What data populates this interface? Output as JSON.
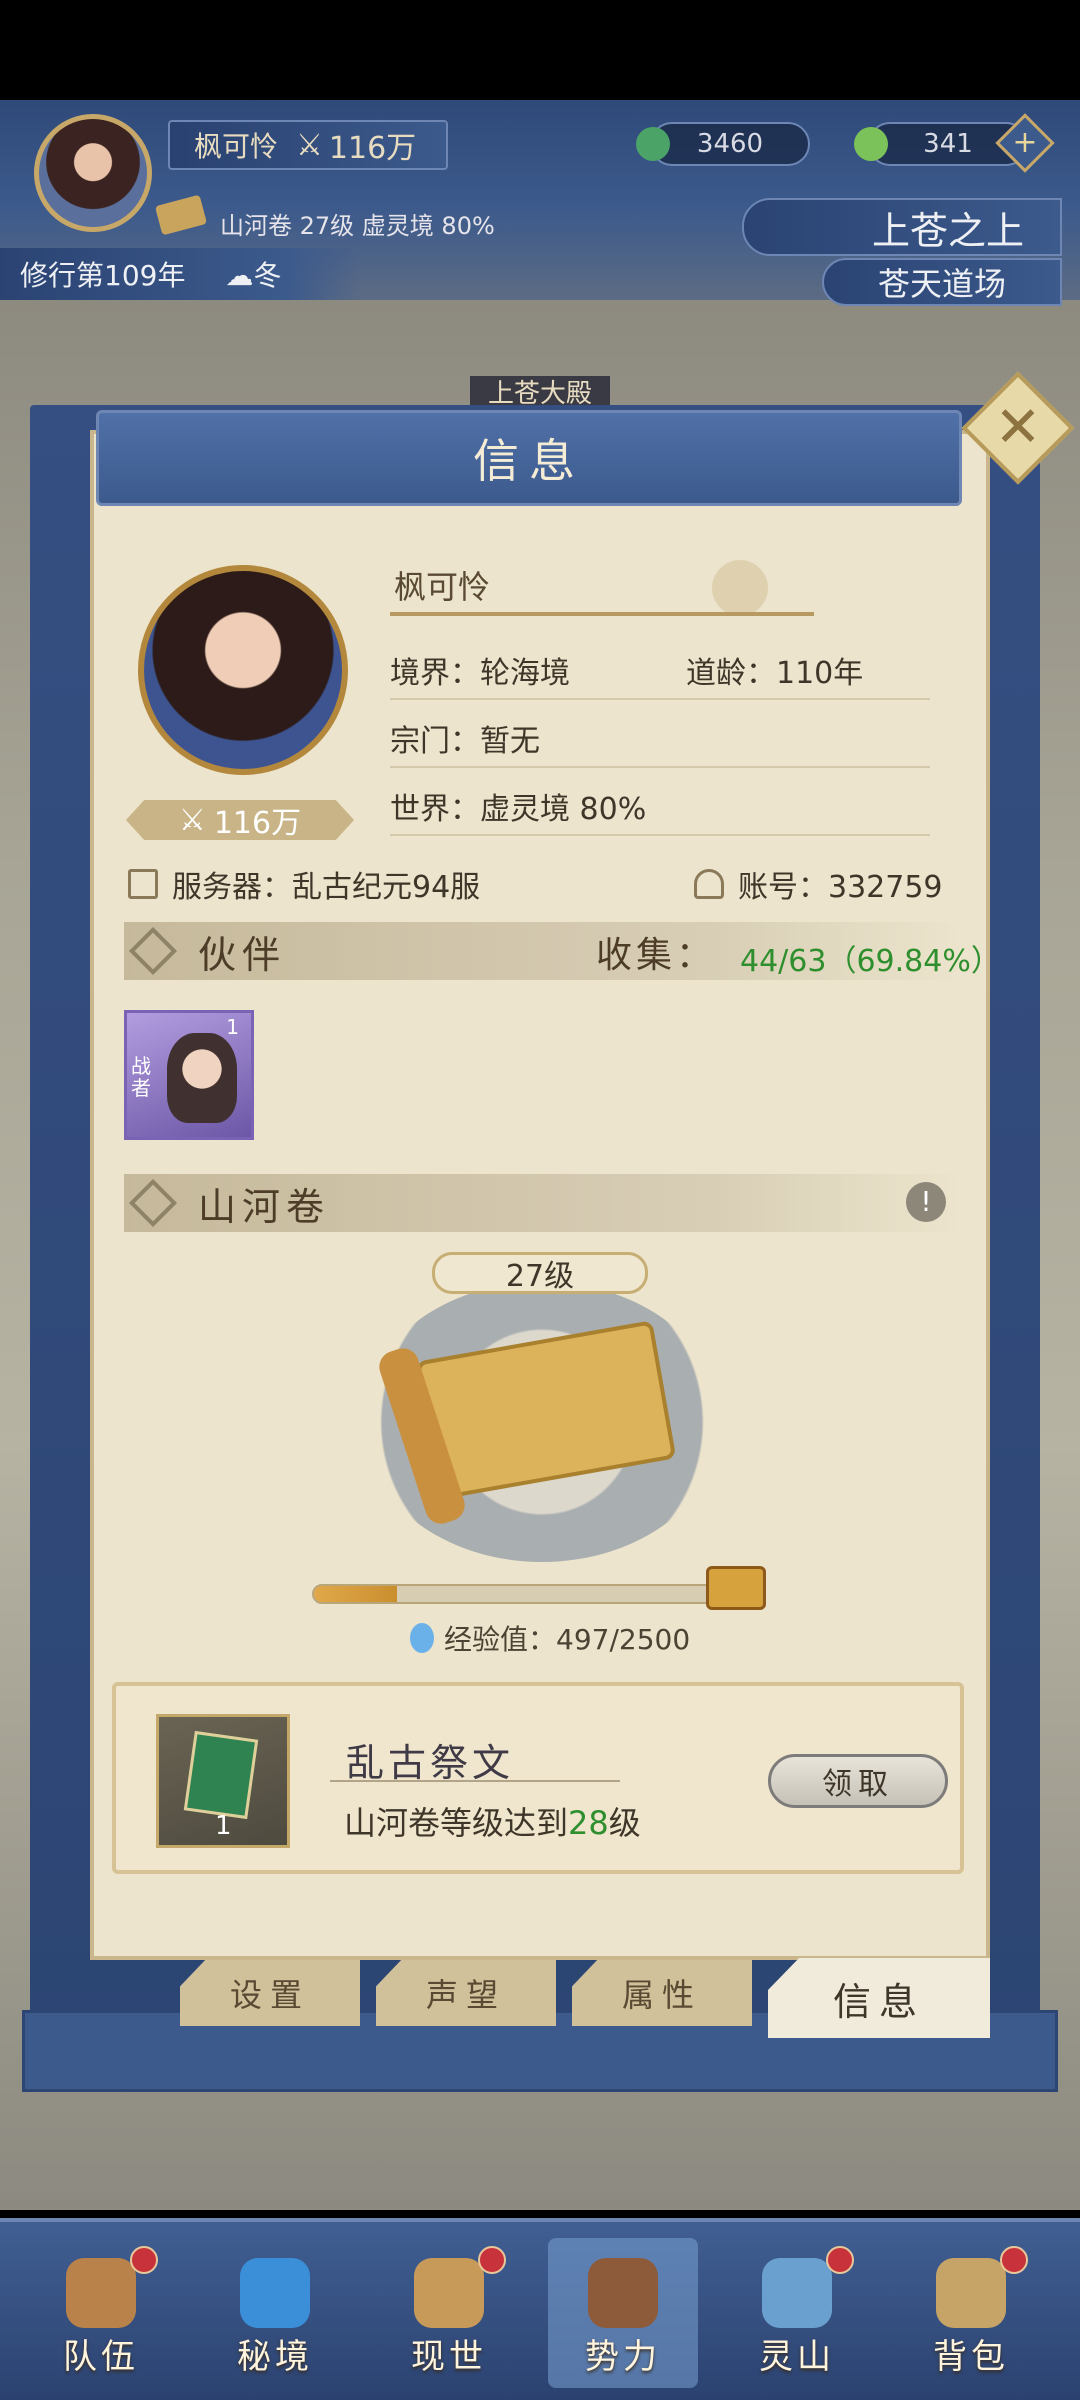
{
  "header": {
    "player_name": "枫可怜",
    "power": "116万",
    "resource_jade": "3460",
    "resource_spirit": "341",
    "scroll_line": "山河卷 27级 虚灵境 80%",
    "cultivation_year": "修行第109年",
    "season": "冬",
    "location_main": "上苍之上",
    "location_sub": "苍天道场",
    "building_sign": "上苍大殿"
  },
  "panel": {
    "title": "信息",
    "close_label": "✕",
    "profile": {
      "name": "枫可怜",
      "power": "116万",
      "realm": "境界：轮海境",
      "age": "道龄：110年",
      "sect": "宗门：暂无",
      "world": "世界：虚灵境  80%",
      "server": "服务器：乱古纪元94服",
      "account": "账号：332759"
    },
    "partners": {
      "title": "伙伴",
      "collect_label": "收集：",
      "collect_value": "44/63（69.84%）",
      "items": [
        {
          "level": "1",
          "tag": "战者"
        }
      ]
    },
    "scroll": {
      "title": "山河卷",
      "warn": "!",
      "level": "27级",
      "xp_label": "经验值：497/2500",
      "xp_fraction": 0.2
    },
    "reward": {
      "title": "乱古祭文",
      "desc_prefix": "山河卷等级达到",
      "desc_level": "28",
      "desc_suffix": "级",
      "count": "1",
      "claim_label": "领取"
    },
    "tabs": [
      {
        "label": "设置",
        "active": false
      },
      {
        "label": "声望",
        "active": false
      },
      {
        "label": "属性",
        "active": false
      },
      {
        "label": "信息",
        "active": true
      }
    ]
  },
  "nav": [
    {
      "label": "队伍",
      "color": "#b9824a",
      "dot": true
    },
    {
      "label": "秘境",
      "color": "#3a8fd8",
      "dot": false
    },
    {
      "label": "现世",
      "color": "#c89a5a",
      "dot": true
    },
    {
      "label": "势力",
      "color": "#8d5a3a",
      "dot": false,
      "active": true
    },
    {
      "label": "灵山",
      "color": "#6aa0d0",
      "dot": true
    },
    {
      "label": "背包",
      "color": "#c6a467",
      "dot": true
    }
  ]
}
